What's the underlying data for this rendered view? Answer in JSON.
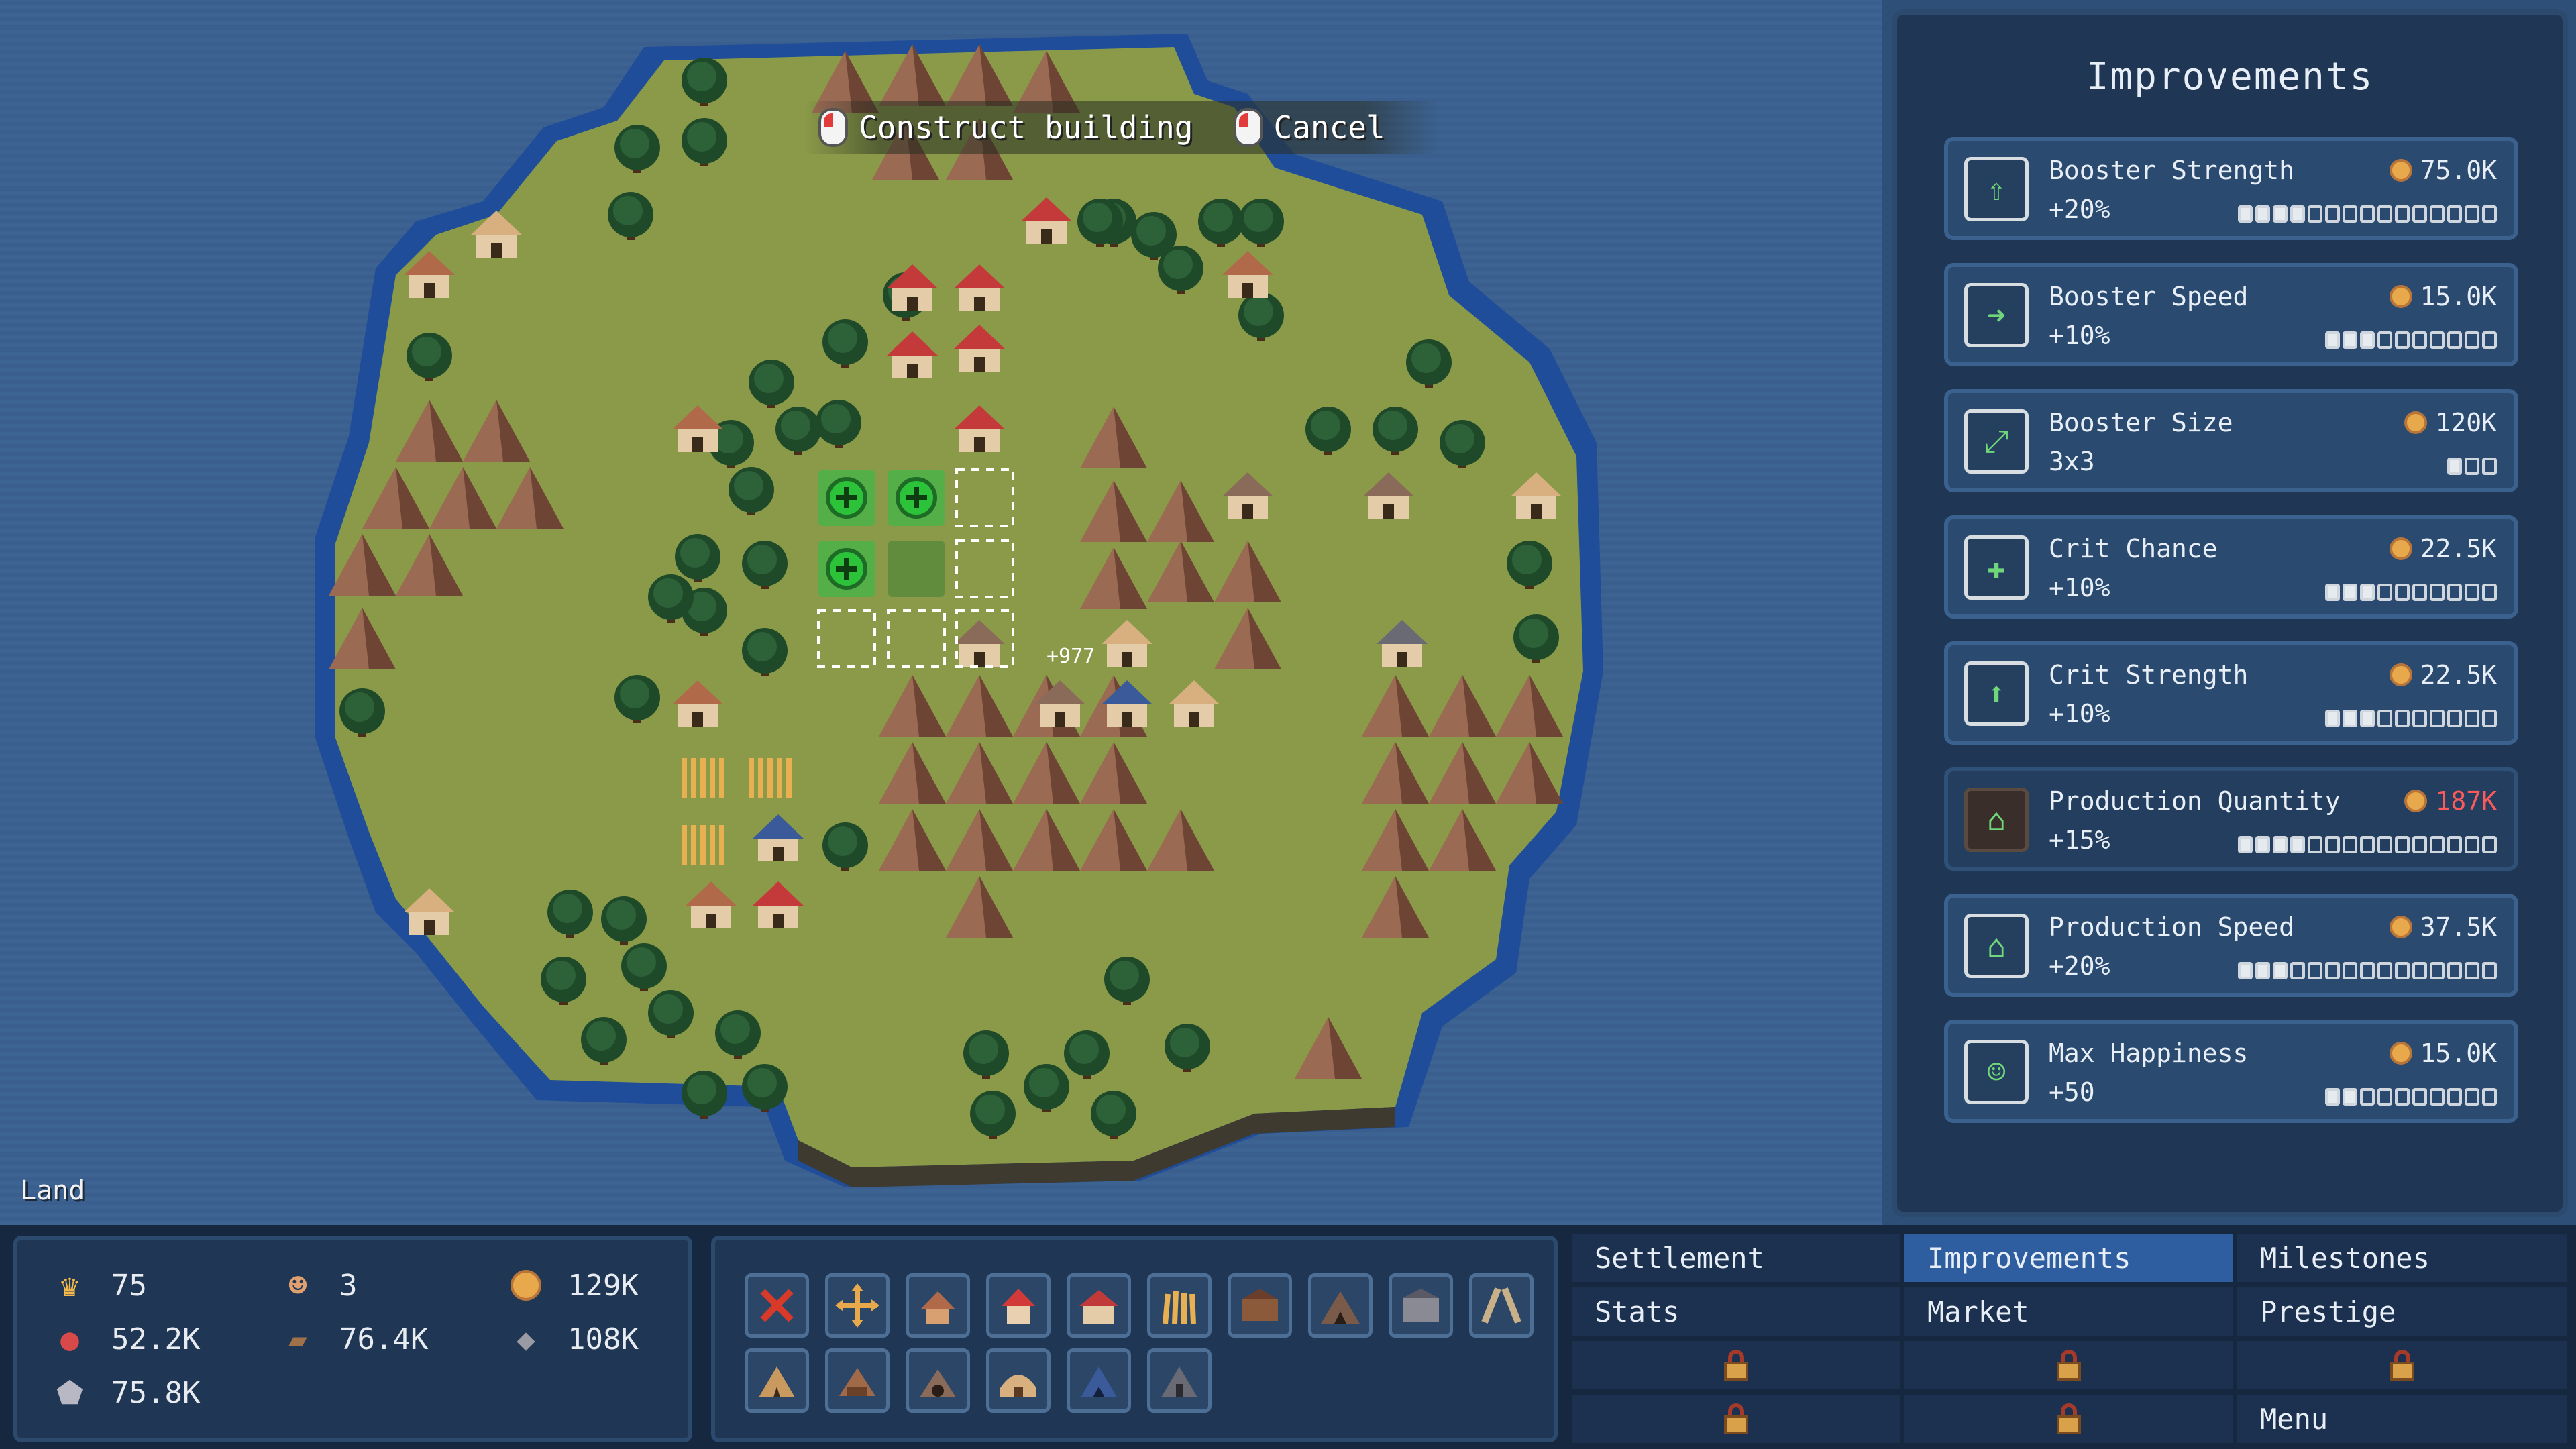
{
  "map": {
    "land_label": "Land",
    "prompt": {
      "construct_label": "Construct building",
      "cancel_label": "Cancel"
    },
    "floating_text": "+977"
  },
  "improvements": {
    "title": "Improvements",
    "items": [
      {
        "name": "Booster Strength",
        "value": "+20%",
        "cost": "75.0K",
        "level": 4,
        "max": 15,
        "icon": "booster-strength-icon",
        "affordable": true
      },
      {
        "name": "Booster Speed",
        "value": "+10%",
        "cost": "15.0K",
        "level": 3,
        "max": 10,
        "icon": "booster-speed-icon",
        "affordable": true
      },
      {
        "name": "Booster Size",
        "value": "3x3",
        "cost": "120K",
        "level": 1,
        "max": 3,
        "icon": "booster-size-icon",
        "affordable": true
      },
      {
        "name": "Crit Chance",
        "value": "+10%",
        "cost": "22.5K",
        "level": 3,
        "max": 10,
        "icon": "crit-chance-icon",
        "affordable": true
      },
      {
        "name": "Crit Strength",
        "value": "+10%",
        "cost": "22.5K",
        "level": 3,
        "max": 10,
        "icon": "crit-strength-icon",
        "affordable": true
      },
      {
        "name": "Production Quantity",
        "value": "+15%",
        "cost": "187K",
        "level": 4,
        "max": 15,
        "icon": "production-quantity-icon",
        "affordable": false
      },
      {
        "name": "Production Speed",
        "value": "+20%",
        "cost": "37.5K",
        "level": 3,
        "max": 15,
        "icon": "production-speed-icon",
        "affordable": true
      },
      {
        "name": "Max Happiness",
        "value": "+50",
        "cost": "15.0K",
        "level": 2,
        "max": 10,
        "icon": "max-happiness-icon",
        "affordable": true
      }
    ]
  },
  "resources": {
    "crown": "75",
    "villagers": "3",
    "gold": "129K",
    "meat": "52.2K",
    "wood": "76.4K",
    "stone": "108K",
    "iron": "75.8K"
  },
  "build_slots": [
    {
      "name": "cancel-build-slot",
      "icon": "x-icon"
    },
    {
      "name": "move-build-slot",
      "icon": "move-icon"
    },
    {
      "name": "hut-slot",
      "icon": "hut-icon"
    },
    {
      "name": "red-house-slot",
      "icon": "red-house-icon"
    },
    {
      "name": "manor-slot",
      "icon": "manor-icon"
    },
    {
      "name": "wheat-field-slot",
      "icon": "wheat-icon"
    },
    {
      "name": "sawmill-slot",
      "icon": "sawmill-icon"
    },
    {
      "name": "mine-slot",
      "icon": "mine-icon"
    },
    {
      "name": "warehouse-slot",
      "icon": "warehouse-icon"
    },
    {
      "name": "road-slot",
      "icon": "road-icon"
    },
    {
      "name": "tent-slot",
      "icon": "tent-icon"
    },
    {
      "name": "lumber-camp-slot",
      "icon": "lumber-camp-icon"
    },
    {
      "name": "stone-pit-slot",
      "icon": "stone-pit-icon"
    },
    {
      "name": "bakery-slot",
      "icon": "bakery-icon"
    },
    {
      "name": "blue-mine-slot",
      "icon": "blue-mine-icon"
    },
    {
      "name": "chapel-slot",
      "icon": "chapel-icon"
    }
  ],
  "menu": {
    "settlement": "Settlement",
    "improvements": "Improvements",
    "milestones": "Milestones",
    "stats": "Stats",
    "market": "Market",
    "prestige": "Prestige",
    "menu": "Menu"
  },
  "colors": {
    "ocean": "#3d6392",
    "grass": "#8a9a48",
    "shore": "#2a4f8c",
    "panel": "#1f3654",
    "active_tab": "#2e5ea0",
    "cost_unaffordable": "#ff5a5a"
  }
}
